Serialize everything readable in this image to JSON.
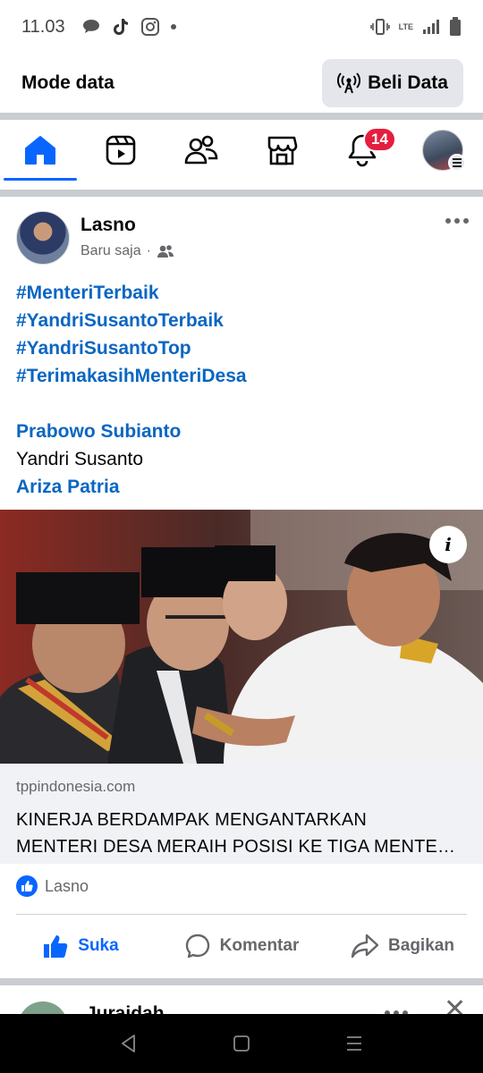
{
  "status_bar": {
    "time": "11.03",
    "network": "LTE"
  },
  "data_bar": {
    "title": "Mode data",
    "button_label": "Beli Data"
  },
  "nav": {
    "notifications_badge": "14"
  },
  "post": {
    "author": "Lasno",
    "time": "Baru saja",
    "hashtags": [
      "#MenteriTerbaik",
      "#YandriSusantoTerbaik",
      "#YandriSusantoTop",
      "#TerimakasihMenteriDesa"
    ],
    "mention_1": "Prabowo Subianto",
    "plain_name": "Yandri Susanto",
    "mention_2": "Ariza Patria",
    "info_label": "i",
    "link_domain": "tppindonesia.com",
    "link_title_line1": "KINERJA BERDAMPAK MENGANTARKAN",
    "link_title_line2": "MENTERI DESA MERAIH POSISI KE TIGA MENTE…",
    "reaction_names": "Lasno",
    "actions": {
      "like": "Suka",
      "comment": "Komentar",
      "share": "Bagikan"
    }
  },
  "next_post": {
    "author": "Juraidah"
  },
  "colors": {
    "accent": "#0866ff",
    "link": "#0a66c2",
    "badge": "#e41e3f"
  }
}
